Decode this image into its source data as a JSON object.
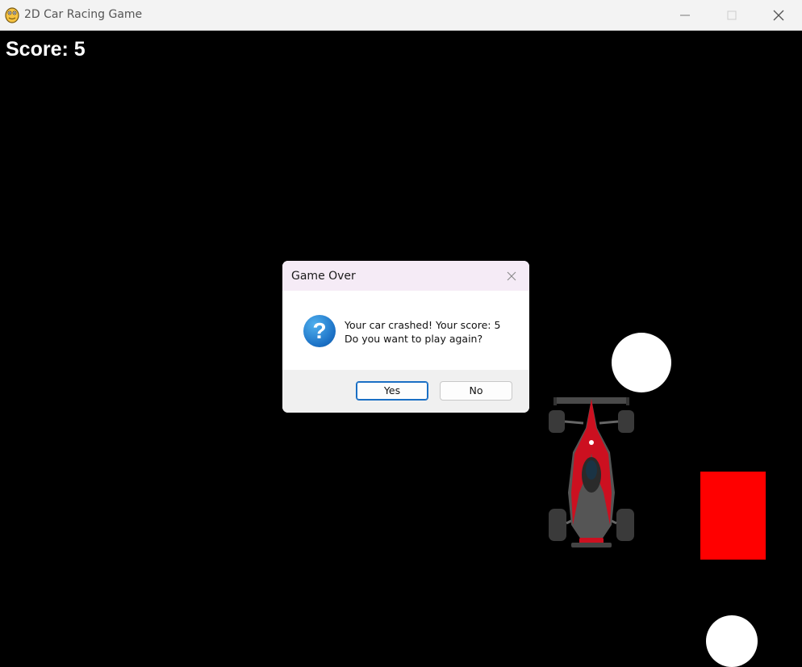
{
  "window": {
    "title": "2D Car Racing Game",
    "icons": {
      "app": "python-snake-icon",
      "minimize": "minimize-icon",
      "maximize": "maximize-icon",
      "close": "close-icon"
    }
  },
  "game": {
    "score_text": "Score: 5",
    "colors": {
      "background": "#000000",
      "obstacle_circle": "#ffffff",
      "obstacle_rect": "#ff0000"
    }
  },
  "dialog": {
    "title": "Game Over",
    "icon": "question-icon",
    "message_line1": "Your car crashed! Your score: 5",
    "message_line2": "Do you want to play again?",
    "buttons": {
      "yes": "Yes",
      "no": "No"
    }
  }
}
